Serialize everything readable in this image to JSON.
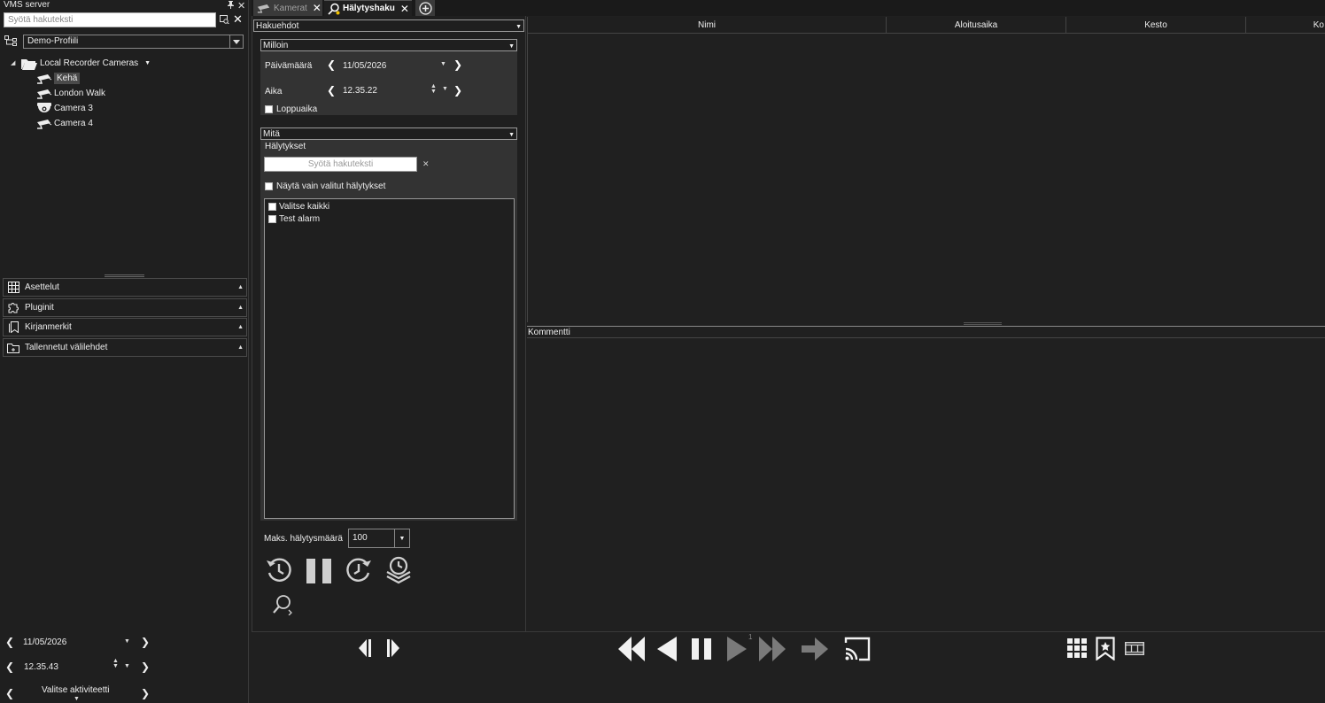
{
  "left_panel": {
    "title": "VMS server",
    "search_placeholder": "Syötä hakuteksti",
    "profile": "Demo-Profiili",
    "tree": {
      "root": "Local Recorder Cameras",
      "cameras": [
        {
          "label": "Kehä",
          "icon": "bullet-camera-icon",
          "selected": true
        },
        {
          "label": "London Walk",
          "icon": "bullet-camera-icon",
          "selected": false
        },
        {
          "label": "Camera 3",
          "icon": "dome-camera-icon",
          "selected": false
        },
        {
          "label": "Camera 4",
          "icon": "bullet-camera-icon",
          "selected": false
        }
      ]
    },
    "accordion": [
      {
        "label": "Asettelut",
        "icon": "grid-icon"
      },
      {
        "label": "Pluginit",
        "icon": "puzzle-icon"
      },
      {
        "label": "Kirjanmerkit",
        "icon": "bookmarks-icon"
      },
      {
        "label": "Tallennetut välilehdet",
        "icon": "saved-tabs-icon"
      }
    ]
  },
  "bottom_left": {
    "date": "11/05/2026",
    "time": "12.35.43",
    "activity": "Valitse aktiviteetti"
  },
  "tabs": [
    {
      "label": "Kamerat",
      "active": false
    },
    {
      "label": "Hälytyshaku",
      "active": true
    }
  ],
  "criteria": {
    "header": "Hakuehdot",
    "when": {
      "header": "Milloin",
      "date_label": "Päivämäärä",
      "date_value": "11/05/2026",
      "time_label": "Aika",
      "time_value": "12.35.22",
      "end_time_label": "Loppuaika"
    },
    "what": {
      "header": "Mitä",
      "alarms_label": "Hälytykset",
      "search_placeholder": "Syötä hakuteksti",
      "only_selected_label": "Näytä vain valitut hälytykset",
      "list": [
        "Valitse kaikki",
        "Test alarm"
      ]
    },
    "max_count_label": "Maks. hälytysmäärä",
    "max_count_value": "100"
  },
  "results": {
    "columns": [
      "Nimi",
      "Aloitusaika",
      "Kesto",
      "Ko"
    ],
    "comment_label": "Kommentti"
  },
  "playback": {
    "speed_badge": "1"
  },
  "colors": {
    "background": "#202020",
    "panel": "#1f1f1f",
    "group": "#333333",
    "text": "#e6e6e6"
  }
}
